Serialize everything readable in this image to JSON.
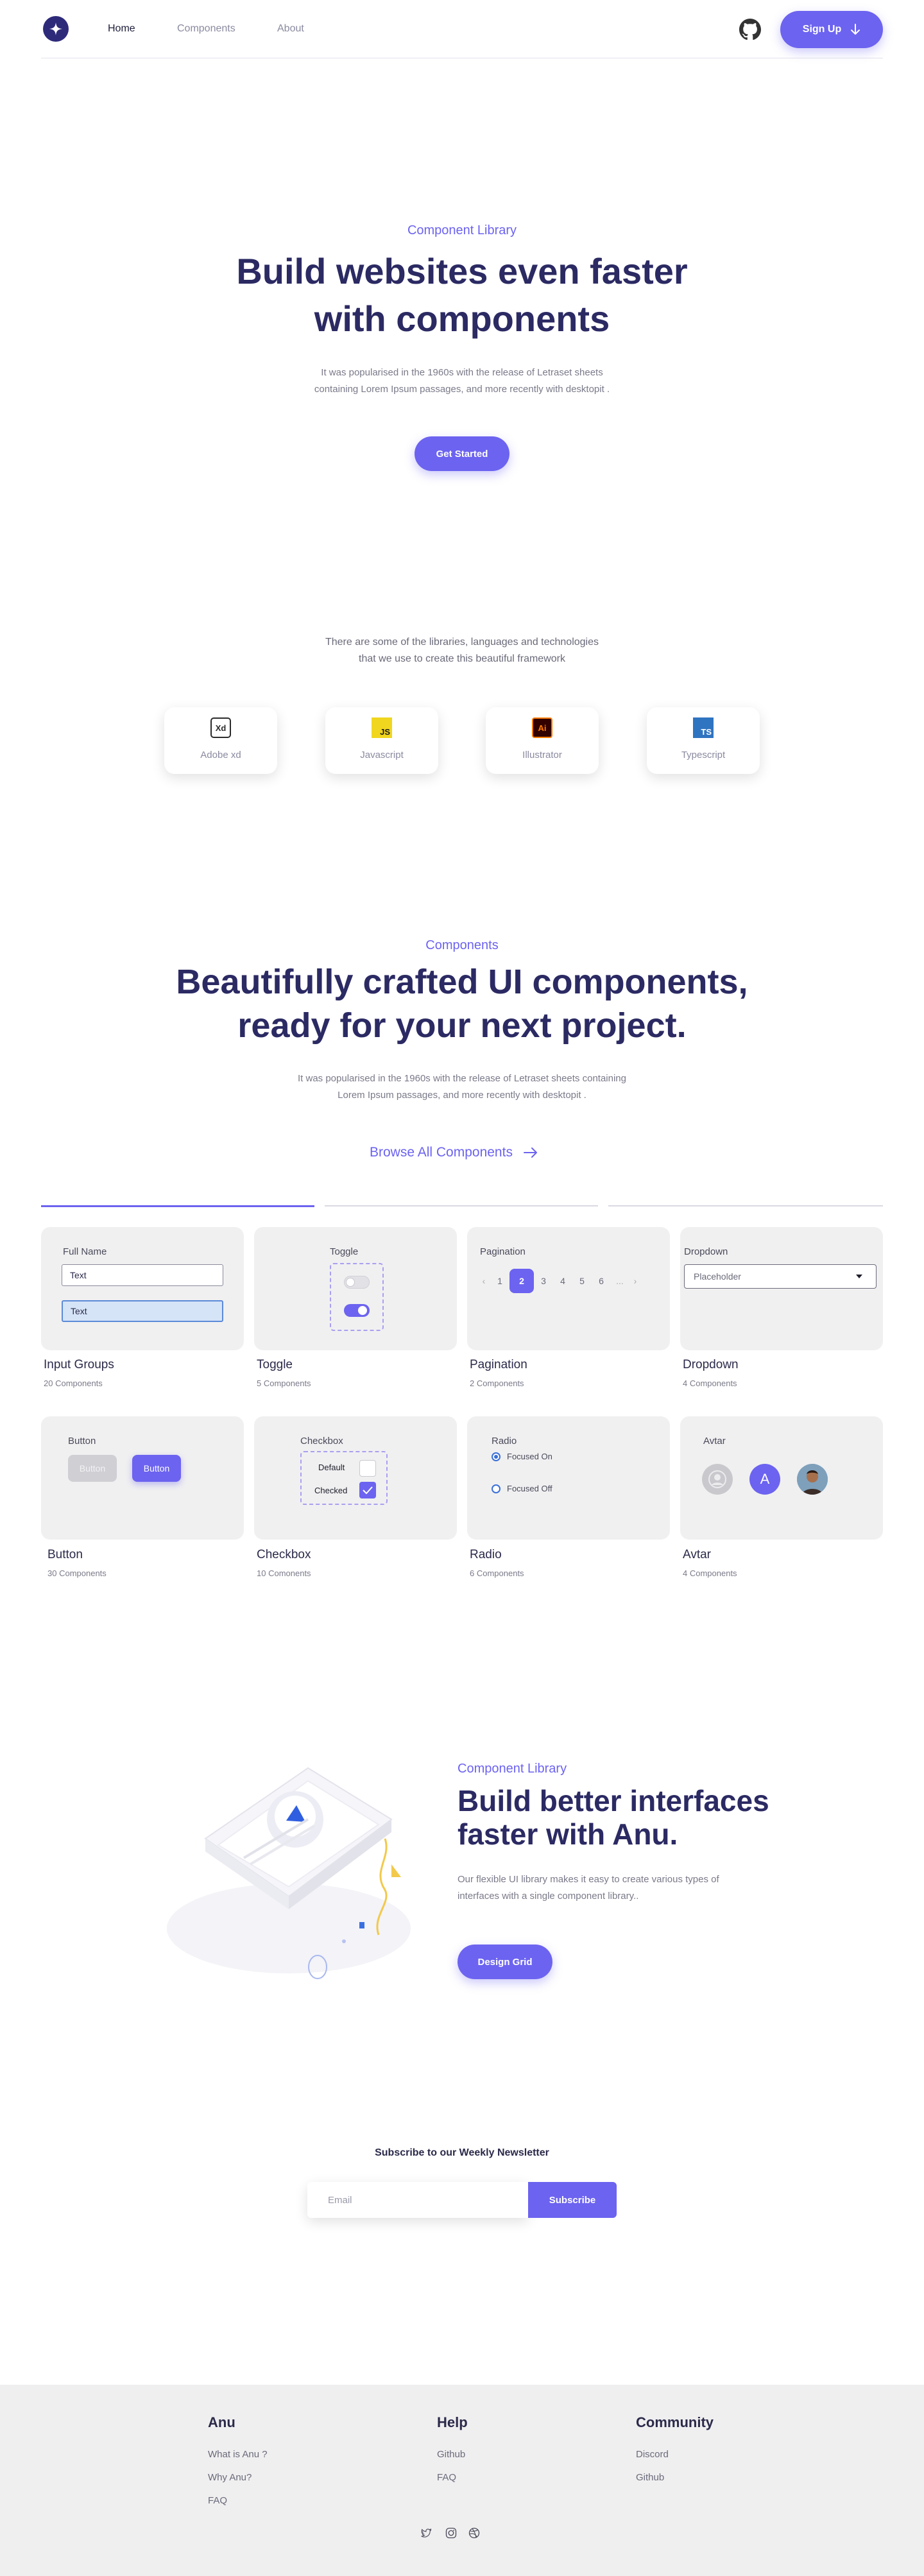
{
  "nav": {
    "links": [
      "Home",
      "Components",
      "About"
    ],
    "signup_label": "Sign Up"
  },
  "hero": {
    "eyebrow": "Component Library",
    "title_line1": "Build websites even faster",
    "title_line2": "with components",
    "lead_line1": "It was popularised in the 1960s with the release of Letraset sheets",
    "lead_line2": "containing Lorem Ipsum passages, and more recently with desktopit .",
    "cta_label": "Get Started"
  },
  "tech": {
    "intro_line1": "There are some of the libraries,  languages and technologies",
    "intro_line2": "that we use to  create this beautiful framework",
    "items": [
      {
        "icon": "Xd",
        "label": "Adobe xd"
      },
      {
        "icon": "JS",
        "label": "Javascript"
      },
      {
        "icon": "Ai",
        "label": "Illustrator"
      },
      {
        "icon": "TS",
        "label": "Typescript"
      }
    ]
  },
  "components": {
    "eyebrow": "Components",
    "title_line1": "Beautifully crafted UI components,",
    "title_line2": "ready for your next project.",
    "lead_line1": "It was popularised in the 1960s with the release of Letraset sheets containing",
    "lead_line2": "Lorem Ipsum passages, and more recently with desktopit .",
    "browse_label": "Browse All Components",
    "cards": [
      {
        "title": "Input  Groups",
        "count": "20 Components"
      },
      {
        "title": "Toggle",
        "count": "5 Components"
      },
      {
        "title": "Pagination",
        "count": "2 Components"
      },
      {
        "title": "Dropdown",
        "count": "4 Components"
      },
      {
        "title": "Button",
        "count": "30 Components"
      },
      {
        "title": "Checkbox",
        "count": "10 Comonents"
      },
      {
        "title": "Radio",
        "count": "6 Components"
      },
      {
        "title": "Avtar",
        "count": "4 Components"
      }
    ],
    "input_demo": {
      "label": "Full Name",
      "value1": "Text",
      "value2": "Text"
    },
    "toggle_demo": {
      "label": "Toggle"
    },
    "pagination_demo": {
      "label": "Pagination",
      "pages": [
        "1",
        "2",
        "3",
        "4",
        "5",
        "6",
        "..."
      ],
      "active": "2"
    },
    "dropdown_demo": {
      "label": "Dropdown",
      "placeholder": "Placeholder"
    },
    "button_demo": {
      "label": "Button",
      "disabled_label": "Button",
      "primary_label": "Button"
    },
    "checkbox_demo": {
      "label": "Checkbox",
      "default_label": "Default",
      "checked_label": "Checked"
    },
    "radio_demo": {
      "label": "Radio",
      "on_label": "Focused On",
      "off_label": "Focused Off"
    },
    "avatar_demo": {
      "label": "Avtar",
      "letter": "A"
    }
  },
  "feature": {
    "eyebrow": "Component Library",
    "title_line1": "Build better interfaces",
    "title_line2": "faster with Anu.",
    "body_line1": "Our flexible UI library makes it easy to create various types of",
    "body_line2": "interfaces with a single component library..",
    "cta_label": "Design Grid"
  },
  "newsletter": {
    "heading": "Subscribe  to our Weekly Newsletter",
    "placeholder": "Email",
    "button_label": "Subscribe"
  },
  "footer": {
    "columns": [
      {
        "heading": "Anu",
        "links": [
          "What is Anu ?",
          "Why Anu?",
          "FAQ"
        ]
      },
      {
        "heading": "Help",
        "links": [
          "Github",
          "FAQ"
        ]
      },
      {
        "heading": "Community",
        "links": [
          "Discord",
          "Github"
        ]
      }
    ],
    "social": [
      "twitter-icon",
      "instagram-icon",
      "dribbble-icon"
    ]
  },
  "colors": {
    "accent": "#6c63f0",
    "heading": "#2b2a63",
    "card_bg": "#f0f0f1",
    "footer_bg": "#efeff0"
  }
}
